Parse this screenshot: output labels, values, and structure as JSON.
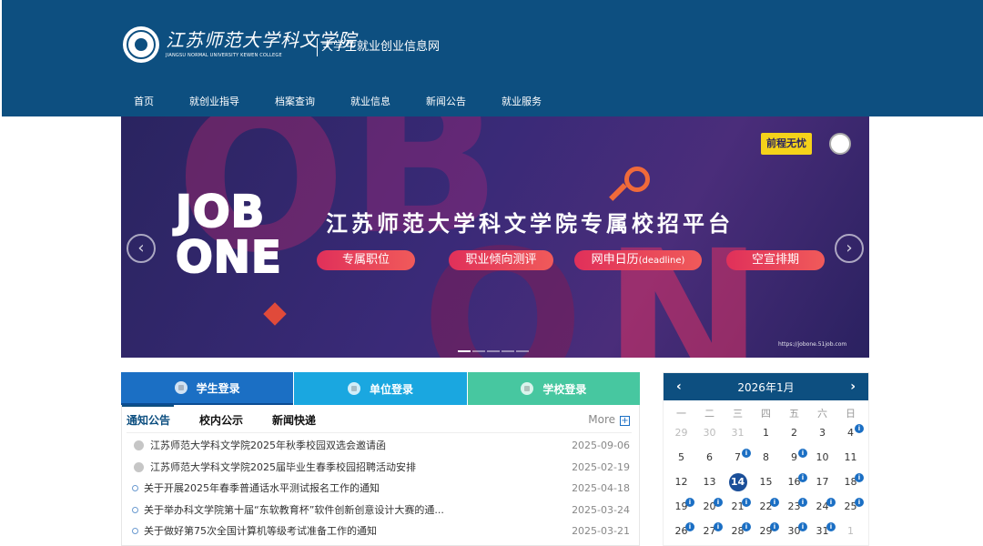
{
  "header": {
    "school_name": "江苏师范大学科文学院",
    "school_name_en": "JIANGSU NORMAL UNIVERSITY KEWEN COLLEGE",
    "site_title": "大学生就业创业信息网",
    "nav": [
      "首页",
      "就创业指导",
      "档案查询",
      "就业信息",
      "新闻公告",
      "就业服务"
    ]
  },
  "banner": {
    "job_text": "JOB\nONE",
    "title": "江苏师范大学科文学院专属校招平台",
    "pills": [
      "专属职位",
      "职业倾向测评",
      "网申日历",
      "空宣排期"
    ],
    "pill_suffix": "(deadline)",
    "brand": "前程无忧",
    "url": "https://jobone.51job.com",
    "bg_letters": [
      "O",
      "B",
      "O",
      "N"
    ],
    "prev_arrow": "‹",
    "next_arrow": "›"
  },
  "login_tabs": [
    "学生登录",
    "单位登录",
    "学校登录"
  ],
  "news": {
    "tabs": [
      "通知公告",
      "校内公示",
      "新闻快递"
    ],
    "more": "More",
    "more_icon": "+",
    "items": [
      {
        "title": "江苏师范大学科文学院2025年秋季校园双选会邀请函",
        "date": "2025-09-06"
      },
      {
        "title": "江苏师范大学科文学院2025届毕业生春季校园招聘活动安排",
        "date": "2025-02-19"
      },
      {
        "title": "关于开展2025年春季普通话水平测试报名工作的通知",
        "date": "2025-04-18"
      },
      {
        "title": "关于举办科文学院第十届“东软教育杯”软件创新创意设计大赛的通...",
        "date": "2025-03-24"
      },
      {
        "title": "关于做好第75次全国计算机等级考试准备工作的通知",
        "date": "2025-03-21"
      }
    ]
  },
  "calendar": {
    "title": "2026年1月",
    "prev": "‹",
    "next": "›",
    "weekdays": [
      "一",
      "二",
      "三",
      "四",
      "五",
      "六",
      "日"
    ],
    "weeks": [
      [
        {
          "d": "29",
          "m": true
        },
        {
          "d": "30",
          "m": true
        },
        {
          "d": "31",
          "m": true
        },
        {
          "d": "1"
        },
        {
          "d": "2"
        },
        {
          "d": "3"
        },
        {
          "d": "4",
          "e": true
        }
      ],
      [
        {
          "d": "5"
        },
        {
          "d": "6"
        },
        {
          "d": "7",
          "e": true
        },
        {
          "d": "8"
        },
        {
          "d": "9",
          "e": true
        },
        {
          "d": "10"
        },
        {
          "d": "11"
        }
      ],
      [
        {
          "d": "12"
        },
        {
          "d": "13"
        },
        {
          "d": "14",
          "t": true
        },
        {
          "d": "15"
        },
        {
          "d": "16",
          "e": true
        },
        {
          "d": "17"
        },
        {
          "d": "18",
          "e": true
        }
      ],
      [
        {
          "d": "19",
          "e": true
        },
        {
          "d": "20",
          "e": true
        },
        {
          "d": "21",
          "e": true
        },
        {
          "d": "22",
          "e": true
        },
        {
          "d": "23",
          "e": true
        },
        {
          "d": "24",
          "e": true
        },
        {
          "d": "25",
          "e": true
        }
      ],
      [
        {
          "d": "26",
          "e": true
        },
        {
          "d": "27",
          "e": true
        },
        {
          "d": "28",
          "e": true
        },
        {
          "d": "29",
          "e": true
        },
        {
          "d": "30",
          "e": true
        },
        {
          "d": "31",
          "e": true
        },
        {
          "d": "1",
          "m": true
        }
      ]
    ]
  }
}
